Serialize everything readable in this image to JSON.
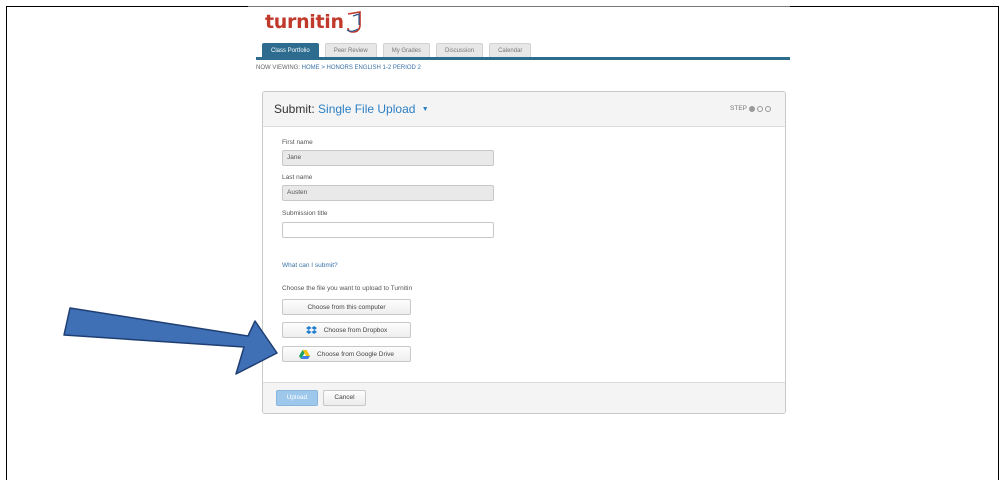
{
  "brand": {
    "name": "turnitin"
  },
  "tabs": [
    {
      "label": "Class Portfolio",
      "active": true
    },
    {
      "label": "Peer Review"
    },
    {
      "label": "My Grades"
    },
    {
      "label": "Discussion"
    },
    {
      "label": "Calendar"
    }
  ],
  "breadcrumb": {
    "prefix": "NOW VIEWING:",
    "path": "HOME > HONORS ENGLISH 1-2 PERIOD 2"
  },
  "panel": {
    "title_prefix": "Submit:",
    "title_mode": "Single File Upload",
    "step_label": "STEP",
    "step_current": 1,
    "step_total": 3
  },
  "form": {
    "first_name_label": "First name",
    "first_name_value": "Jane",
    "last_name_label": "Last name",
    "last_name_value": "Austen",
    "submission_title_label": "Submission title",
    "submission_title_value": "",
    "help_link": "What can I submit?",
    "choose_prompt": "Choose the file you want to upload to Turnitin"
  },
  "sources": {
    "computer": "Choose from this computer",
    "dropbox": "Choose from Dropbox",
    "google_drive": "Choose from Google Drive"
  },
  "footer": {
    "upload": "Upload",
    "cancel": "Cancel"
  },
  "colors": {
    "brand_red": "#c0392b",
    "tab_active": "#2d6c8f",
    "link_blue": "#2d80c4",
    "arrow_fill": "#3f6fb5",
    "arrow_stroke": "#1f3f73"
  }
}
